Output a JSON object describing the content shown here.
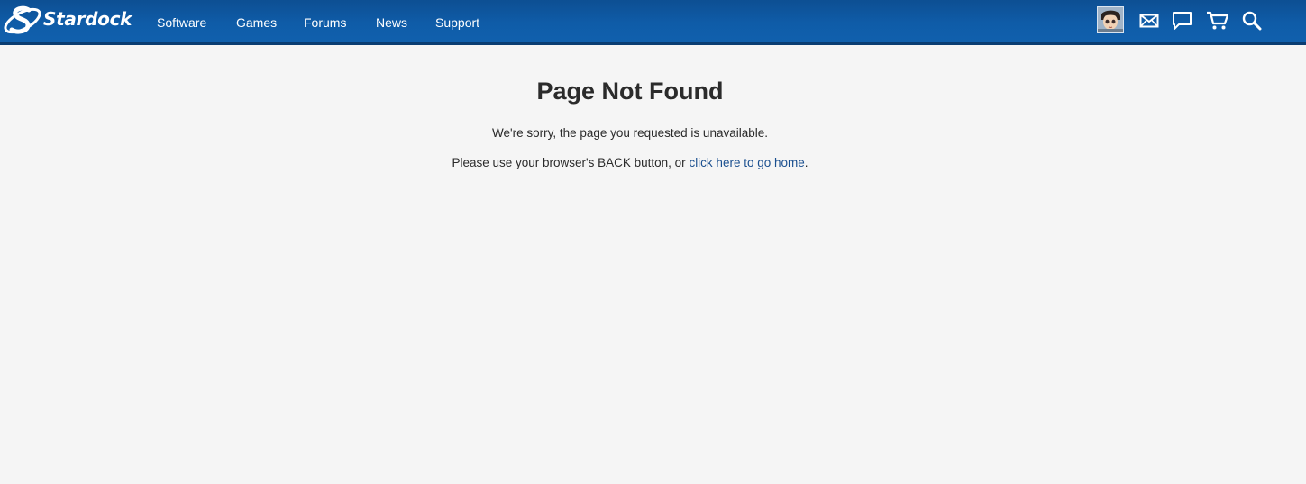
{
  "header": {
    "logo_text": "Stardock",
    "nav": [
      {
        "label": "Software"
      },
      {
        "label": "Games"
      },
      {
        "label": "Forums"
      },
      {
        "label": "News"
      },
      {
        "label": "Support"
      }
    ],
    "icons": [
      "avatar",
      "mail-icon",
      "chat-icon",
      "cart-icon",
      "search-icon"
    ]
  },
  "main": {
    "title": "Page Not Found",
    "message": "We're sorry, the page you requested is unavailable.",
    "instruction_prefix": "Please use your browser's BACK button, or ",
    "home_link": "click here to go home",
    "instruction_suffix": "."
  },
  "colors": {
    "header_bg": "#0f5ca8",
    "page_bg": "#f5f5f5",
    "link": "#1a4f8f"
  }
}
